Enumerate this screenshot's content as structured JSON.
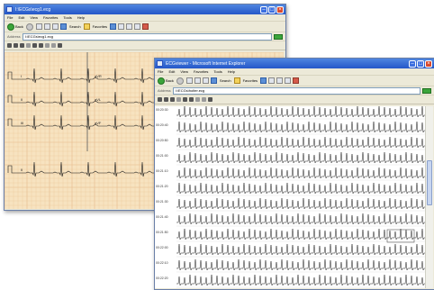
{
  "window_back": {
    "title": "I:\\ECGs\\ecg1.ecg",
    "menus": [
      "File",
      "Edit",
      "View",
      "Favorites",
      "Tools",
      "Help"
    ],
    "back_label": "Back",
    "search_label": "Search",
    "favorites_label": "Favorites",
    "address_label": "Address",
    "address_value": "I:\\ECGs\\ecg1.ecg",
    "lead_labels": [
      "I",
      "II",
      "III",
      "aVR",
      "aVL",
      "aVF",
      "II"
    ]
  },
  "window_front": {
    "title": "ECGviewer - Microsoft Internet Explorer",
    "menus": [
      "File",
      "Edit",
      "View",
      "Favorites",
      "Tools",
      "Help"
    ],
    "back_label": "Back",
    "search_label": "Search",
    "favorites_label": "Favorites",
    "address_label": "Address",
    "address_value": "I:\\ECGs\\holter.ecg",
    "time_labels": [
      "00:20:30",
      "00:20:40",
      "00:20:50",
      "00:21:00",
      "00:21:10",
      "00:21:20",
      "00:21:30",
      "00:21:40",
      "00:21:50",
      "00:22:00",
      "00:22:10",
      "00:22:20"
    ]
  },
  "colors": {
    "ecg_paper": "#f7e3c0",
    "ecg_grid": "#e6b98a",
    "trace": "#1a1a1a",
    "xp_title": "#2a5fd0"
  },
  "icons": [
    "back-arrow-icon",
    "forward-arrow-icon",
    "stop-icon",
    "refresh-icon",
    "home-icon",
    "search-icon",
    "favorites-icon",
    "history-icon",
    "mail-icon",
    "print-icon",
    "zoom-icon"
  ]
}
